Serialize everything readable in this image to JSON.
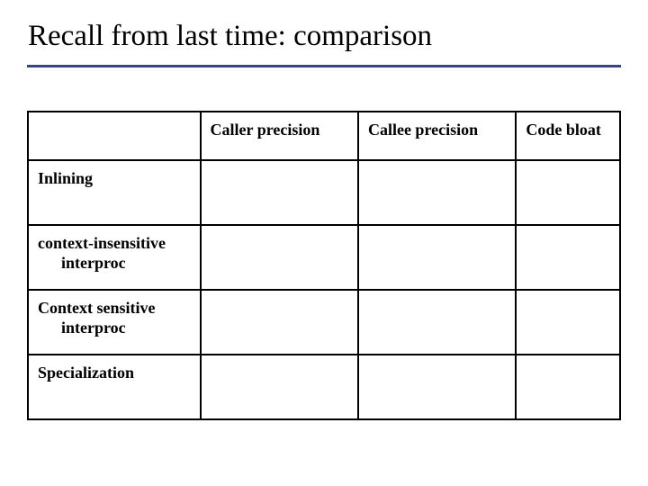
{
  "title": "Recall from last time: comparison",
  "table": {
    "headers": [
      "",
      "Caller precision",
      "Callee precision",
      "Code bloat"
    ],
    "rows": [
      {
        "label": "Inlining",
        "indent": "",
        "c1": "",
        "c2": "",
        "c3": ""
      },
      {
        "label": "context-insensitive",
        "indent": "interproc",
        "c1": "",
        "c2": "",
        "c3": ""
      },
      {
        "label": "Context sensitive",
        "indent": "interproc",
        "c1": "",
        "c2": "",
        "c3": ""
      },
      {
        "label": "Specialization",
        "indent": "",
        "c1": "",
        "c2": "",
        "c3": ""
      }
    ]
  }
}
